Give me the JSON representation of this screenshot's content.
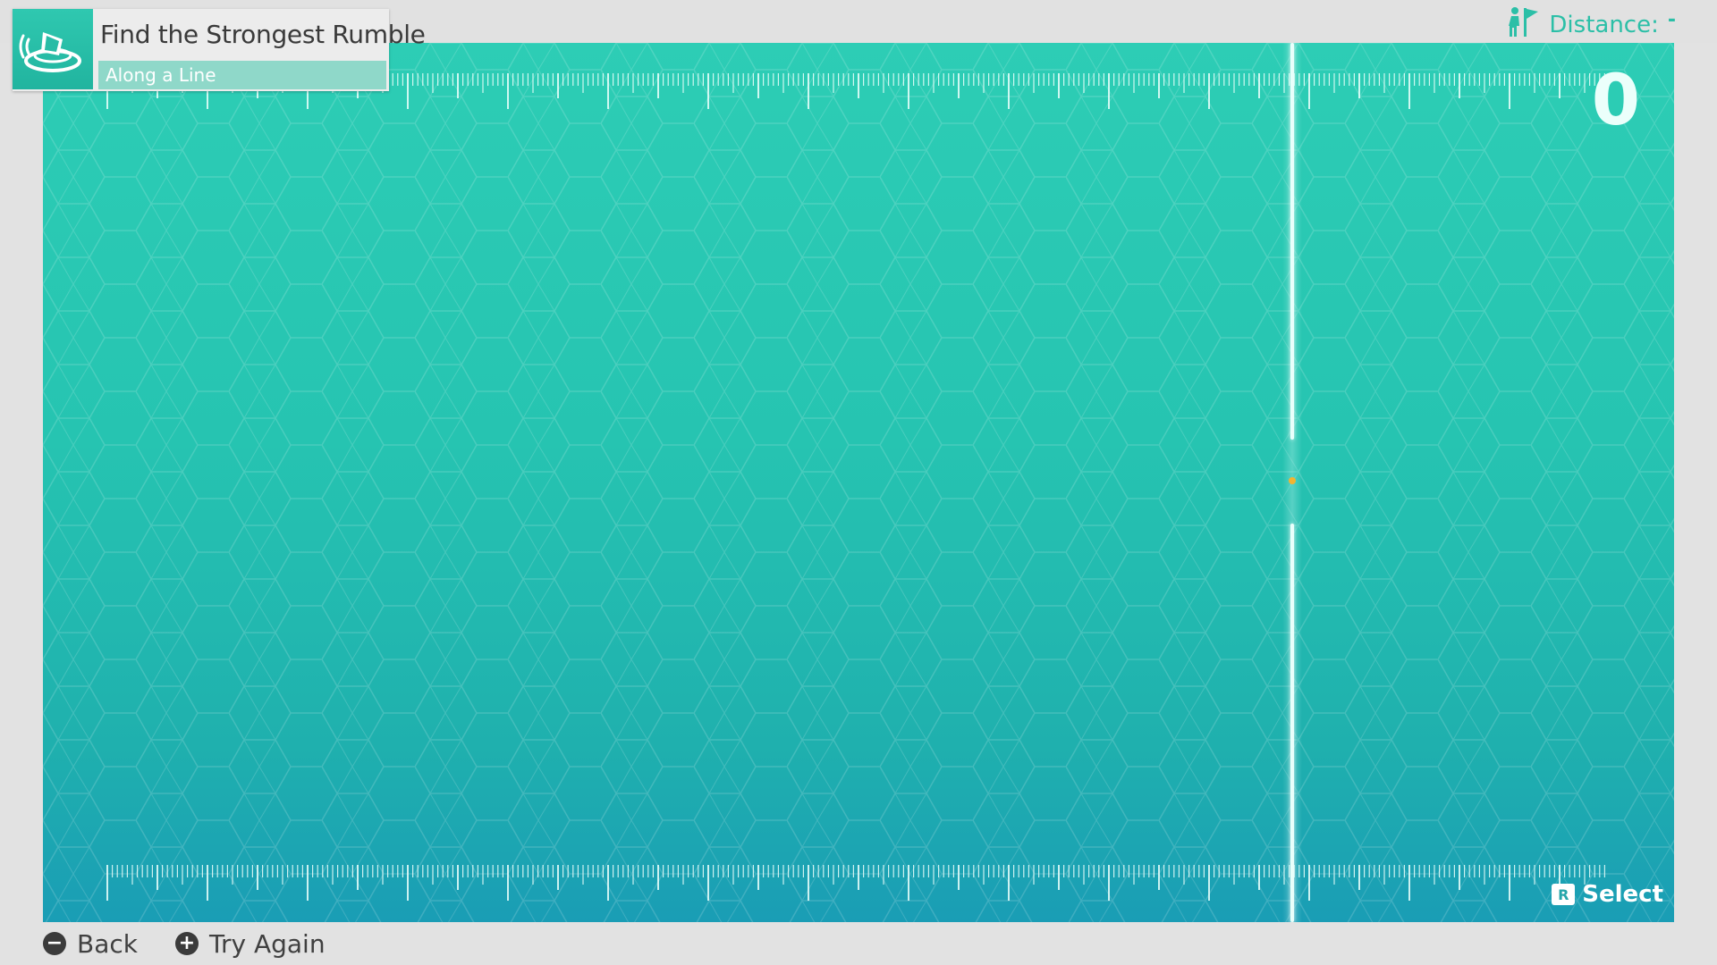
{
  "title": {
    "main": "Find the Strongest Rumble",
    "sub": "Along a Line",
    "icon": "rumble-plate-icon"
  },
  "status": {
    "distance_label": "Distance:",
    "distance_value": "-",
    "flag_icon": "person-flag-icon"
  },
  "game": {
    "score": "0",
    "select_key": "R",
    "select_label": "Select",
    "sweep_position": 0.763
  },
  "footer": {
    "back_key_glyph": "−",
    "back_label": "Back",
    "try_key_glyph": "+",
    "try_label": "Try Again"
  },
  "colors": {
    "accent": "#2bbfa7",
    "background": "#e2e2e2",
    "field_top": "#2dcdb5",
    "field_bottom": "#1a9db5",
    "marker": "#f2b431"
  }
}
